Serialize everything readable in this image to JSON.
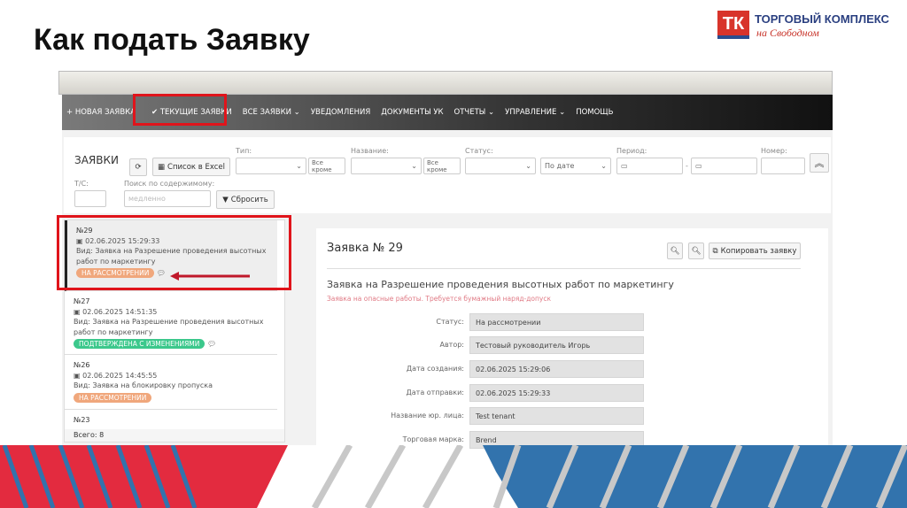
{
  "slide": {
    "title": "Как подать Заявку"
  },
  "logo": {
    "mark": "ТК",
    "line1": "ТОРГОВЫЙ КОМПЛЕКС",
    "line2": "на Свободном"
  },
  "nav": {
    "items": [
      "+ НОВАЯ ЗАЯВКА",
      "✔ ТЕКУЩИЕ ЗАЯВКИ",
      "ВСЕ ЗАЯВКИ ⌄",
      "УВЕДОМЛЕНИЯ",
      "ДОКУМЕНТЫ УК",
      "ОТЧЕТЫ ⌄",
      "УПРАВЛЕНИЕ ⌄",
      "ПОМОЩЬ"
    ],
    "active": 1
  },
  "filters": {
    "heading": "ЗАЯВКИ",
    "excel": "Список в Excel",
    "type_label": "Тип:",
    "name_label": "Название:",
    "status_label": "Статус:",
    "period_label": "Период:",
    "number_label": "Номер:",
    "except": "Все кроме",
    "sort": "По дате",
    "ts_label": "Т/С:",
    "search_label": "Поиск по содержимому:",
    "search_placeholder": "медленно",
    "reset": "Сбросить",
    "dash": "-"
  },
  "list": {
    "items": [
      {
        "num": "№29",
        "date": "02.06.2025 15:29:33",
        "kind": "Вид: Заявка на Разрешение проведения высотных работ по маркетингу",
        "status": "НА РАССМОТРЕНИИ",
        "status_color": "#f0a77c"
      },
      {
        "num": "№27",
        "date": "02.06.2025 14:51:35",
        "kind": "Вид: Заявка на Разрешение проведения высотных работ по маркетингу",
        "status": "ПОДТВЕРЖДЕНА С ИЗМЕНЕНИЯМИ",
        "status_color": "#3cc88c"
      },
      {
        "num": "№26",
        "date": "02.06.2025 14:45:55",
        "kind": "Вид: Заявка на блокировку пропуска",
        "status": "НА РАССМОТРЕНИИ",
        "status_color": "#f0a77c"
      },
      {
        "num": "№23"
      }
    ],
    "total": "Всего: 8"
  },
  "detail": {
    "title": "Заявка № 29",
    "copy": "Копировать заявку",
    "subject": "Заявка на Разрешение проведения высотных работ по маркетингу",
    "warning": "Заявка на опасные работы. Требуется бумажный наряд-допуск",
    "fields": [
      {
        "k": "Статус:",
        "v": "На рассмотрении"
      },
      {
        "k": "Автор:",
        "v": "Тестовый руководитель Игорь"
      },
      {
        "k": "Дата создания:",
        "v": "02.06.2025 15:29:06"
      },
      {
        "k": "Дата отправки:",
        "v": "02.06.2025 15:29:33"
      },
      {
        "k": "Название юр. лица:",
        "v": "Test tenant"
      },
      {
        "k": "Торговая марка:",
        "v": "Brend"
      }
    ]
  },
  "colors": {
    "highlight": "#e0141b",
    "red": "#e32b3f",
    "blue": "#3273ad"
  }
}
